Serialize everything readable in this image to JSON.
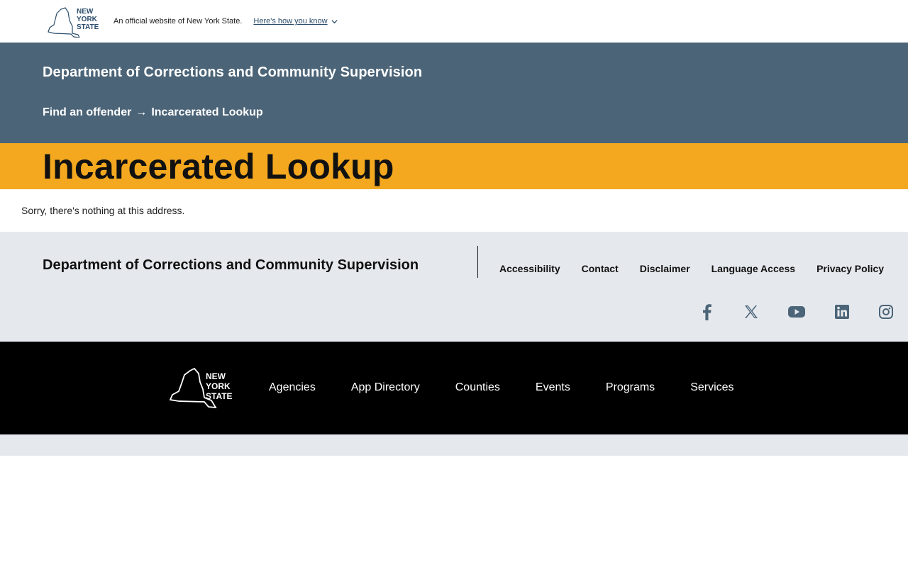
{
  "official_bar": {
    "logo_alt": "NEW YORK STATE",
    "logo_lines": [
      "NEW",
      "YORK",
      "STATE"
    ],
    "text": "An official website of New York State.",
    "how_link": "Here's how you know"
  },
  "agency_header": {
    "name": "Department of Corrections and Community Supervision",
    "breadcrumb": {
      "parent": "Find an offender",
      "separator": "→",
      "current": "Incarcerated Lookup"
    }
  },
  "page": {
    "title": "Incarcerated Lookup",
    "message": "Sorry, there's nothing at this address."
  },
  "footer": {
    "agency_name": "Department of Corrections and Community Supervision",
    "links": [
      "Accessibility",
      "Contact",
      "Disclaimer",
      "Language Access",
      "Privacy Policy"
    ],
    "social_icons": [
      "facebook-icon",
      "x-icon",
      "youtube-icon",
      "linkedin-icon",
      "instagram-icon"
    ]
  },
  "state_footer": {
    "logo_lines": [
      "NEW",
      "YORK",
      "STATE"
    ],
    "links": [
      "Agencies",
      "App Directory",
      "Counties",
      "Events",
      "Programs",
      "Services"
    ]
  },
  "colors": {
    "header_bg": "#4b6478",
    "title_band": "#f4a81f",
    "footer_bg": "#e5e9ed",
    "state_footer_bg": "#000000",
    "social_icon": "#4b6478"
  }
}
